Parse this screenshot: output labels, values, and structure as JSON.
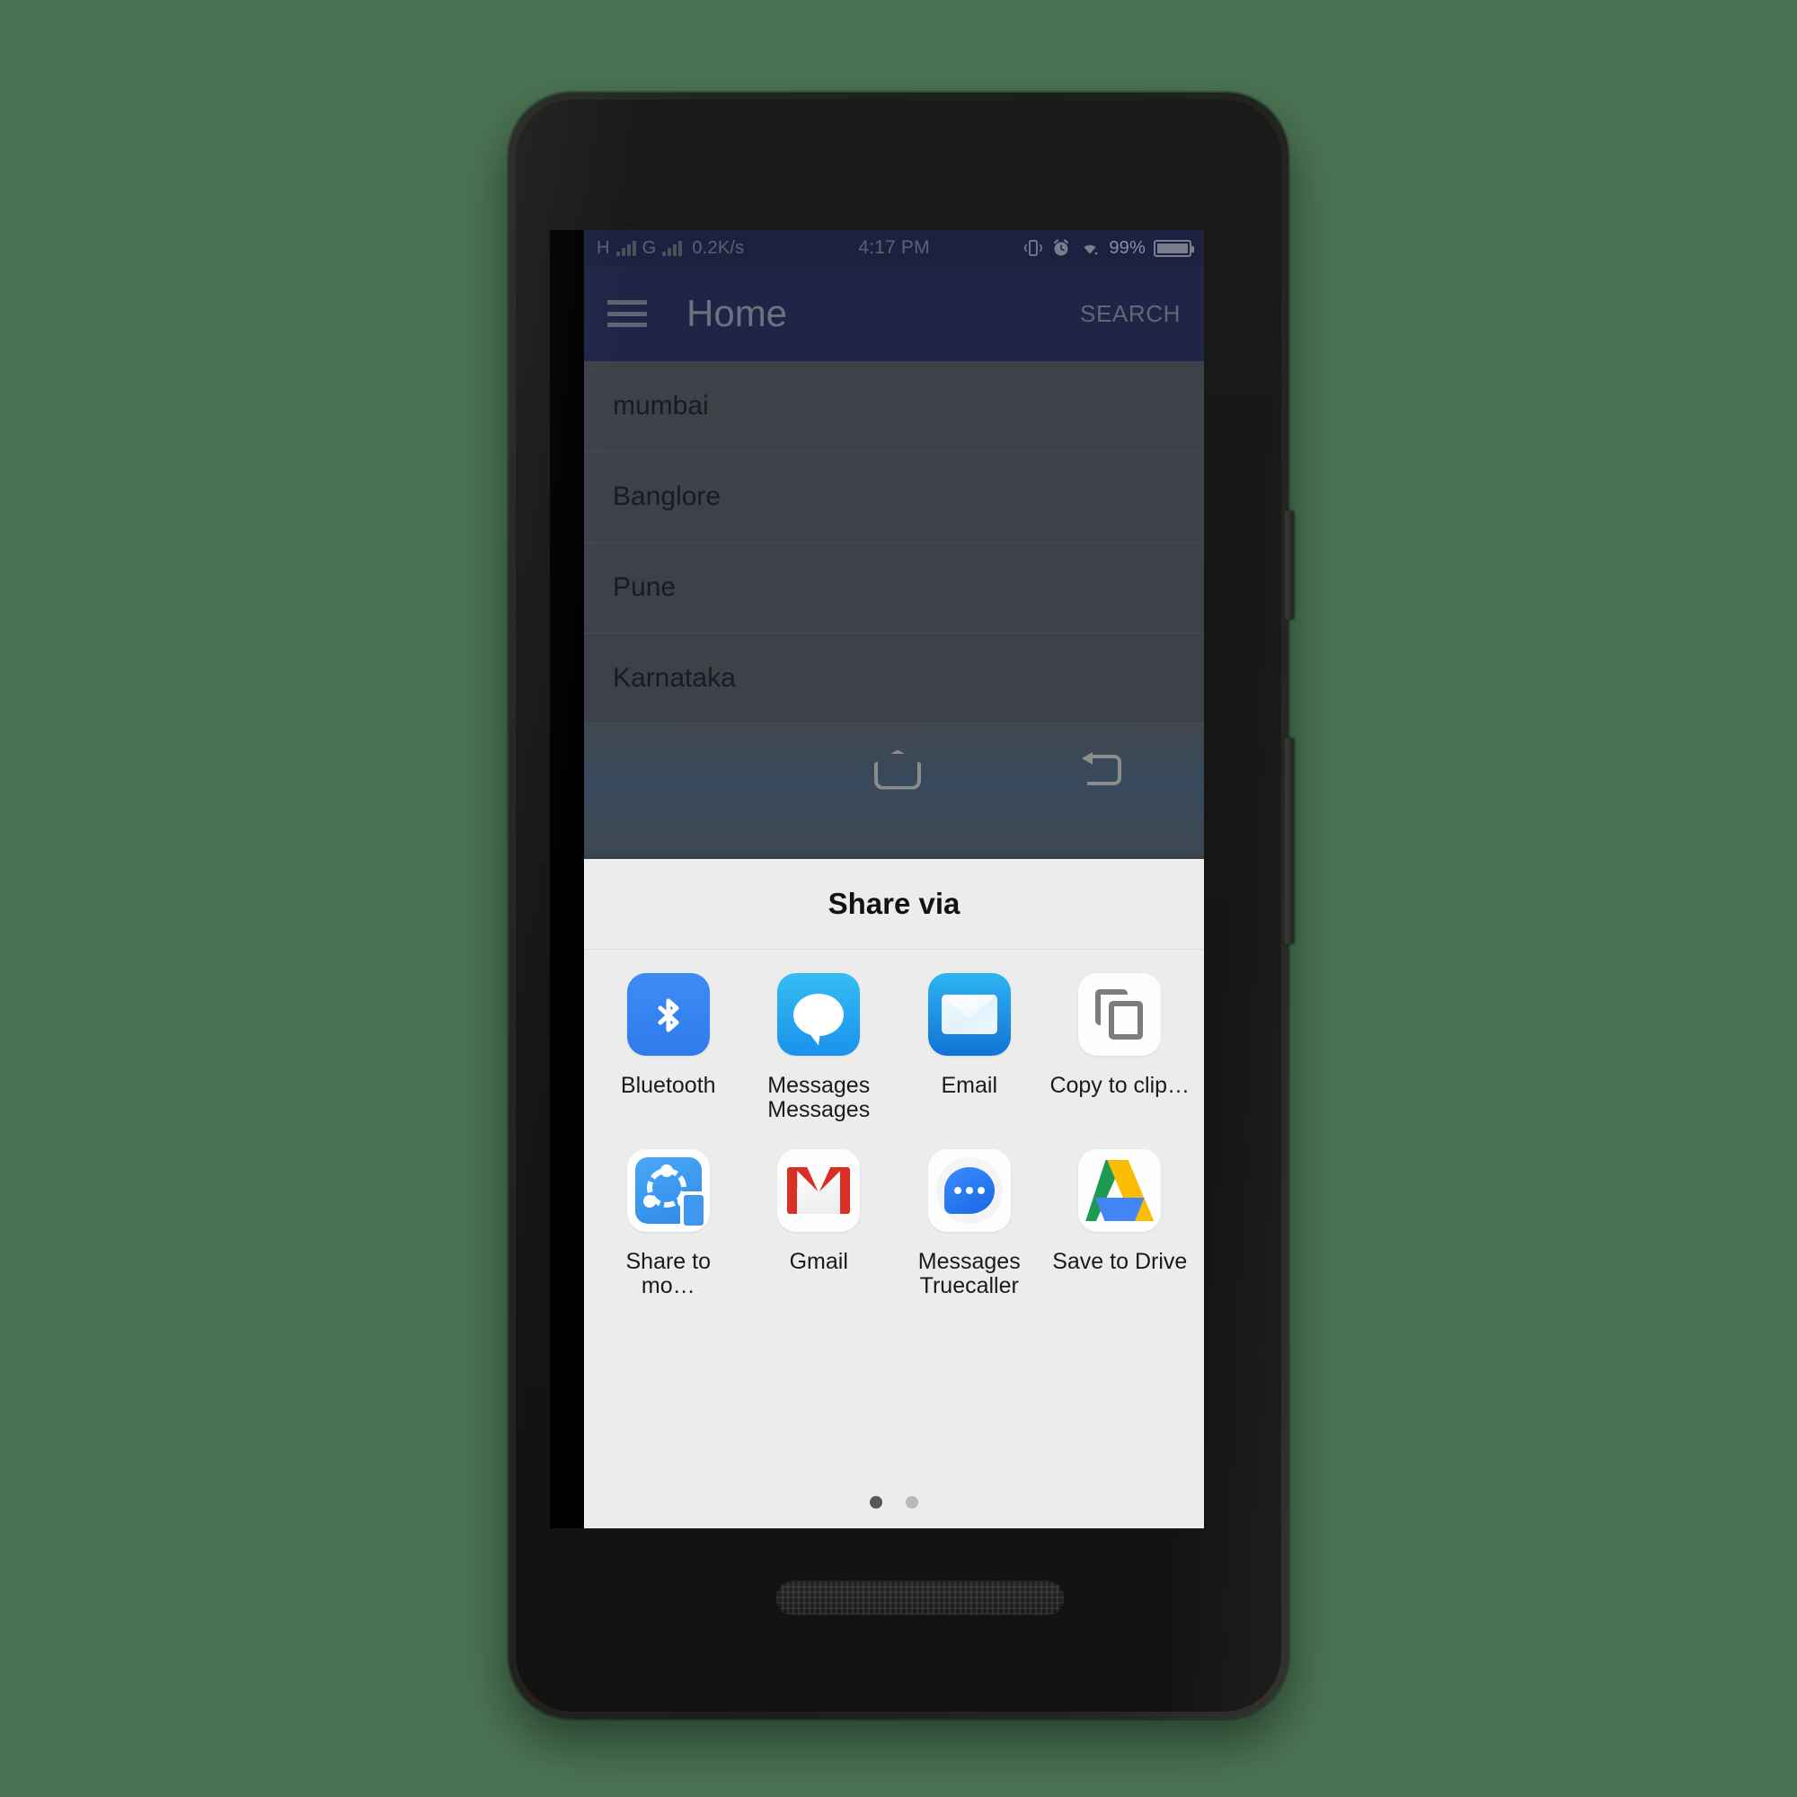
{
  "device": {
    "camera_icon": "front-camera-icon",
    "speaker_icon": "speaker-grille-icon",
    "power_button": "power-button",
    "volume_button": "volume-button"
  },
  "status_bar": {
    "network_primary": "H",
    "network_secondary": "G",
    "data_speed": "0.2K/s",
    "time": "4:17 PM",
    "vibrate_icon": "vibrate-icon",
    "alarm_icon": "alarm-clock-icon",
    "wifi_icon": "wifi-icon",
    "battery_percent": "99%",
    "battery_icon": "battery-icon"
  },
  "app_bar": {
    "menu_icon": "hamburger-menu-icon",
    "title": "Home",
    "action": "SEARCH"
  },
  "list": {
    "items": [
      {
        "label": "mumbai"
      },
      {
        "label": "Banglore"
      },
      {
        "label": "Pune"
      },
      {
        "label": "Karnataka"
      }
    ]
  },
  "share_sheet": {
    "title": "Share via",
    "items": [
      {
        "label": "Bluetooth",
        "icon": "bluetooth-icon"
      },
      {
        "label": "Messages\nMessages",
        "icon": "messages-icon"
      },
      {
        "label": "Email",
        "icon": "email-icon"
      },
      {
        "label": "Copy to clip…",
        "icon": "copy-to-clipboard-icon"
      },
      {
        "label": "Share to mo…",
        "icon": "share-to-mobile-icon"
      },
      {
        "label": "Gmail",
        "icon": "gmail-icon"
      },
      {
        "label": "Messages\nTruecaller",
        "icon": "truecaller-messages-icon"
      },
      {
        "label": "Save to Drive",
        "icon": "google-drive-icon"
      }
    ],
    "page_count": 2,
    "active_page": 1
  },
  "nav_bar": {
    "recents_icon": "recents-icon",
    "home_icon": "home-icon",
    "back_icon": "back-icon"
  },
  "colors": {
    "background": "#4a7353",
    "status_bar": "#1b2050",
    "app_bar": "#22275c",
    "sheet_bg": "#ececec",
    "nav_bar": "#e4e4e4"
  }
}
